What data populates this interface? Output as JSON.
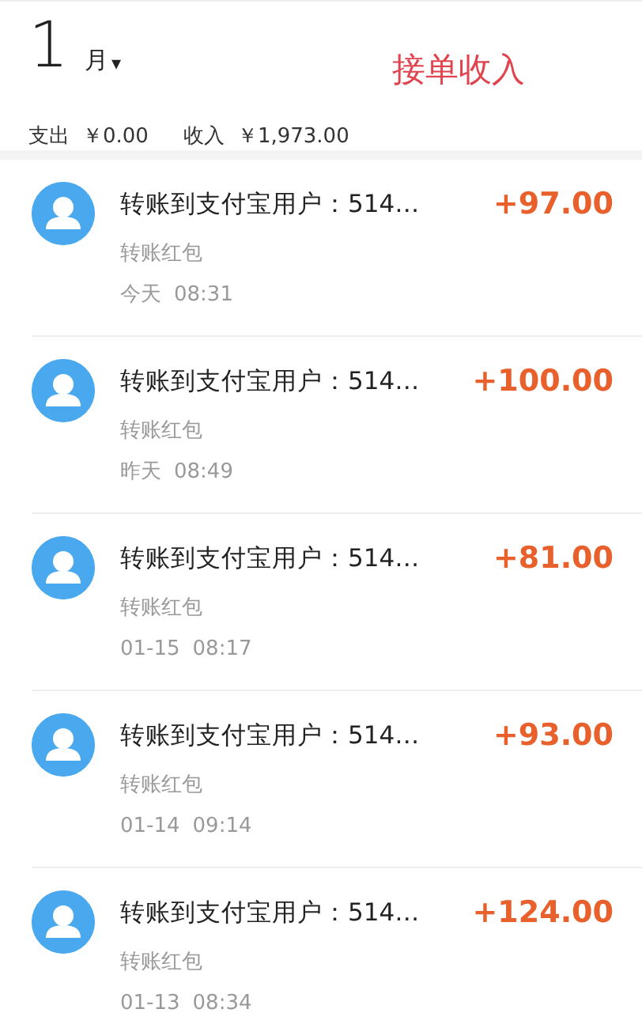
{
  "header": {
    "month_number": "1",
    "month_unit": "月",
    "dropdown_caret": "▾",
    "annotation": "接单收入",
    "expense_label": "支出",
    "expense_amount": "￥0.00",
    "income_label": "收入",
    "income_amount": "￥1,973.00"
  },
  "transactions": [
    {
      "title": "转账到支付宝用户：514…",
      "category": "转账红包",
      "date": "今天",
      "time": "08:31",
      "amount": "+97.00"
    },
    {
      "title": "转账到支付宝用户：514…",
      "category": "转账红包",
      "date": "昨天",
      "time": "08:49",
      "amount": "+100.00"
    },
    {
      "title": "转账到支付宝用户：514…",
      "category": "转账红包",
      "date": "01-15",
      "time": "08:17",
      "amount": "+81.00"
    },
    {
      "title": "转账到支付宝用户：514…",
      "category": "转账红包",
      "date": "01-14",
      "time": "09:14",
      "amount": "+93.00"
    },
    {
      "title": "转账到支付宝用户：514…",
      "category": "转账红包",
      "date": "01-13",
      "time": "08:34",
      "amount": "+124.00"
    }
  ]
}
